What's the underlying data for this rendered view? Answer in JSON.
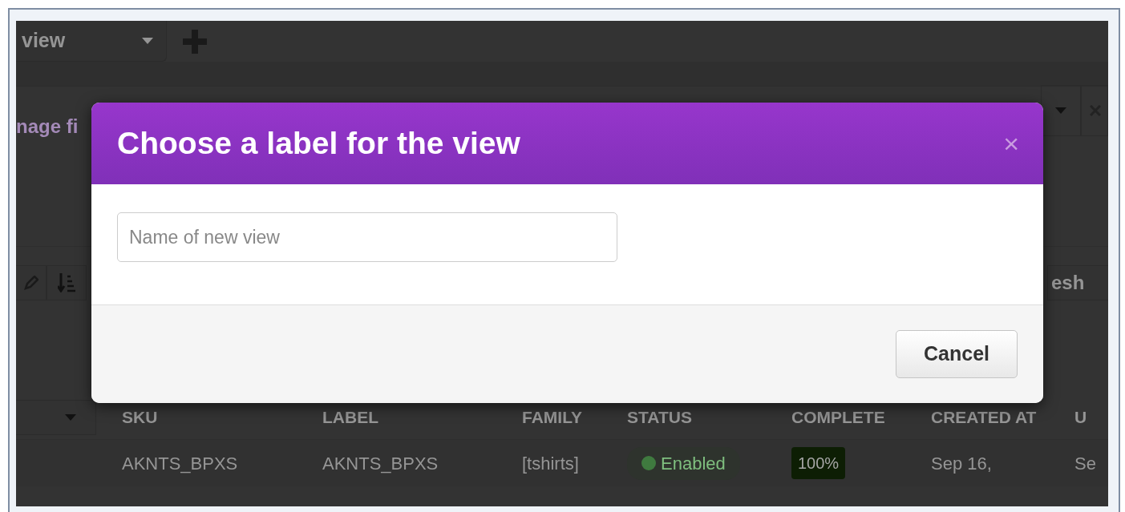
{
  "toolbar": {
    "view_select": {
      "value": "view"
    }
  },
  "filters": {
    "manage_link": "nage fi"
  },
  "actions": {
    "refresh_button": "esh"
  },
  "table": {
    "columns": [
      "SKU",
      "LABEL",
      "FAMILY",
      "STATUS",
      "COMPLETE",
      "CREATED AT",
      "U"
    ],
    "rows": [
      {
        "sku": "AKNTS_BPXS",
        "label": "AKNTS_BPXS",
        "family": "[tshirts]",
        "status": "Enabled",
        "complete": "100%",
        "created_at": "Sep 16,",
        "column_7": "Se"
      }
    ]
  },
  "modal": {
    "title": "Choose a label for the view",
    "close": "×",
    "input": {
      "placeholder": "Name of new view"
    },
    "buttons": [
      "Cancel"
    ]
  }
}
